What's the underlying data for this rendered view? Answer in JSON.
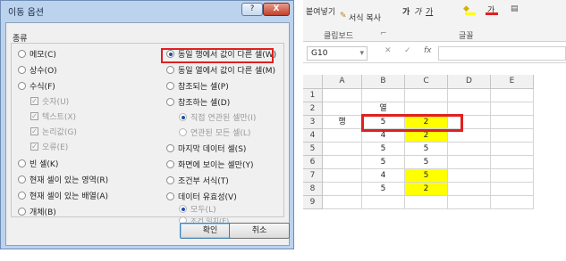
{
  "dialog": {
    "title": "이동 옵션",
    "help_label": "?",
    "close_label": "X",
    "group_label": "종류",
    "left_options": [
      {
        "label": "메모(C)",
        "type": "radio",
        "selected": false,
        "disabled": false
      },
      {
        "label": "상수(O)",
        "type": "radio",
        "selected": false,
        "disabled": false
      },
      {
        "label": "수식(F)",
        "type": "radio",
        "selected": false,
        "disabled": false
      },
      {
        "label": "숫자(U)",
        "type": "check",
        "checked": true,
        "disabled": true
      },
      {
        "label": "텍스트(X)",
        "type": "check",
        "checked": true,
        "disabled": true
      },
      {
        "label": "논리값(G)",
        "type": "check",
        "checked": true,
        "disabled": true
      },
      {
        "label": "오류(E)",
        "type": "check",
        "checked": true,
        "disabled": true
      },
      {
        "label": "빈 셀(K)",
        "type": "radio",
        "selected": false,
        "disabled": false
      },
      {
        "label": "현재 셀이 있는 영역(R)",
        "type": "radio",
        "selected": false,
        "disabled": false
      },
      {
        "label": "현재 셀이 있는 배열(A)",
        "type": "radio",
        "selected": false,
        "disabled": false
      },
      {
        "label": "개체(B)",
        "type": "radio",
        "selected": false,
        "disabled": false
      }
    ],
    "right_options": [
      {
        "label": "동일 행에서 값이 다른 셀(W)",
        "type": "radio",
        "selected": true,
        "disabled": false
      },
      {
        "label": "동일 열에서 값이 다른 셀(M)",
        "type": "radio",
        "selected": false,
        "disabled": false
      },
      {
        "label": "참조되는 셀(P)",
        "type": "radio",
        "selected": false,
        "disabled": false
      },
      {
        "label": "참조하는 셀(D)",
        "type": "radio",
        "selected": false,
        "disabled": false
      },
      {
        "label": "직접 연관된 셀만(I)",
        "type": "radio",
        "selected": true,
        "disabled": true
      },
      {
        "label": "연관된 모든 셀(L)",
        "type": "radio",
        "selected": false,
        "disabled": true
      },
      {
        "label": "마지막 데이터 셀(S)",
        "type": "radio",
        "selected": false,
        "disabled": false
      },
      {
        "label": "화면에 보이는 셀만(Y)",
        "type": "radio",
        "selected": false,
        "disabled": false
      },
      {
        "label": "조건부 서식(T)",
        "type": "radio",
        "selected": false,
        "disabled": false
      },
      {
        "label": "데이터 유효성(V)",
        "type": "radio",
        "selected": false,
        "disabled": false
      },
      {
        "label": "모두(L)",
        "type": "radio",
        "selected": true,
        "disabled": true
      },
      {
        "label": "조건 일치(E)",
        "type": "radio",
        "selected": false,
        "disabled": true
      }
    ],
    "ok_label": "확인",
    "cancel_label": "취소"
  },
  "excel": {
    "ribbon": {
      "paste_label": "붙여넣기",
      "format_painter": "서식 복사",
      "font_buttons": [
        "가",
        "가",
        "가"
      ],
      "clipboard_group": "클립보드",
      "font_group": "글꼴",
      "launcher": "⌐"
    },
    "name_box": "G10",
    "fx_label": "fx",
    "cancel_icon": "✕",
    "enter_icon": "✓",
    "columns": [
      "A",
      "B",
      "C",
      "D",
      "E"
    ],
    "rows": [
      {
        "num": "1",
        "cells": [
          "",
          "",
          "",
          "",
          ""
        ]
      },
      {
        "num": "2",
        "cells": [
          "",
          "열",
          "",
          "",
          ""
        ]
      },
      {
        "num": "3",
        "cells": [
          "행",
          "5",
          "2",
          "",
          ""
        ]
      },
      {
        "num": "4",
        "cells": [
          "",
          "4",
          "2",
          "",
          ""
        ]
      },
      {
        "num": "5",
        "cells": [
          "",
          "5",
          "5",
          "",
          ""
        ]
      },
      {
        "num": "6",
        "cells": [
          "",
          "5",
          "5",
          "",
          ""
        ]
      },
      {
        "num": "7",
        "cells": [
          "",
          "4",
          "5",
          "",
          ""
        ]
      },
      {
        "num": "8",
        "cells": [
          "",
          "5",
          "2",
          "",
          ""
        ]
      },
      {
        "num": "9",
        "cells": [
          "",
          "",
          "",
          "",
          ""
        ]
      }
    ],
    "highlighted_cells": [
      "C3",
      "C4",
      "C7",
      "C8"
    ],
    "colors": {
      "highlight_fill": "#ffff00",
      "annotation_red": "#e02020"
    }
  }
}
